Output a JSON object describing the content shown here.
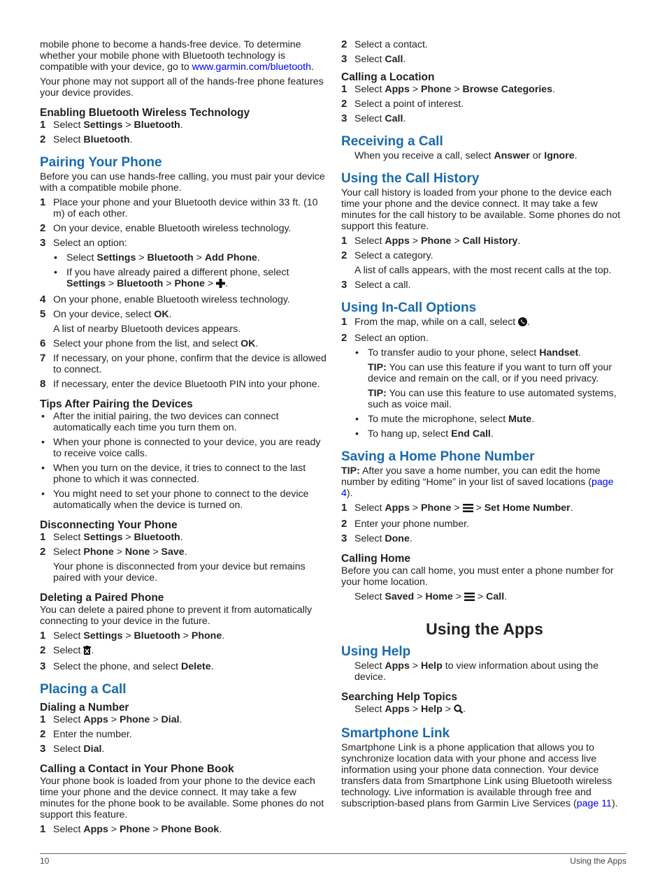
{
  "left": {
    "intro": {
      "p1_text": "mobile phone to become a hands-free device. To determine whether your mobile phone with Bluetooth technology is compatible with your device, go to ",
      "p1_link": "www.garmin.com/bluetooth",
      "p1_end": ".",
      "p2": "Your phone may not support all of the hands-free phone features your device provides."
    },
    "enabling": {
      "title": "Enabling Bluetooth Wireless Technology",
      "s1_num": "1",
      "s1_pre": "Select ",
      "s1_b1": "Settings",
      "s1_sep": " > ",
      "s1_b2": "Bluetooth",
      "s1_end": ".",
      "s2_num": "2",
      "s2_pre": "Select ",
      "s2_b1": "Bluetooth",
      "s2_end": "."
    },
    "pairing": {
      "title": "Pairing Your Phone",
      "intro": "Before you can use hands-free calling, you must pair your device with a compatible mobile phone.",
      "s1_num": "1",
      "s1": "Place your phone and your Bluetooth device within 33 ft. (10 m) of each other.",
      "s2_num": "2",
      "s2": "On your device, enable Bluetooth wireless technology.",
      "s3_num": "3",
      "s3": "Select an option:",
      "b1_pre": "Select ",
      "b1_a": "Settings",
      "b1_b": "Bluetooth",
      "b1_c": "Add Phone",
      "b2_pre": "If you have already paired a different phone, select ",
      "b2_a": "Settings",
      "b2_b": "Bluetooth",
      "b2_c": "Phone",
      "sep": " > ",
      "dot": "•",
      "end": ".",
      "s4_num": "4",
      "s4": "On your phone, enable Bluetooth wireless technology.",
      "s5_num": "5",
      "s5_pre": "On your device, select ",
      "s5_b": "OK",
      "s5_note": "A list of nearby Bluetooth devices appears.",
      "s6_num": "6",
      "s6_pre": "Select your phone from the list, and select ",
      "s6_b": "OK",
      "s7_num": "7",
      "s7": "If necessary, on your phone, confirm that the device is allowed to connect.",
      "s8_num": "8",
      "s8": "If necessary, enter the device Bluetooth PIN into your phone."
    },
    "tips": {
      "title": "Tips After Pairing the Devices",
      "items": [
        "After the initial pairing, the two devices can connect automatically each time you turn them on.",
        "When your phone is connected to your device, you are ready to receive voice calls.",
        "When you turn on the device, it tries to connect to the last phone to which it was connected.",
        "You might need to set your phone to connect to the device automatically when the device is turned on."
      ]
    },
    "disconnecting": {
      "title": "Disconnecting Your Phone",
      "s1_num": "1",
      "s1_pre": "Select ",
      "s1_a": "Settings",
      "s1_b": "Bluetooth",
      "s2_num": "2",
      "s2_pre": "Select ",
      "s2_a": "Phone",
      "s2_b": "None",
      "s2_c": "Save",
      "note": "Your phone is disconnected from your device but remains paired with your device."
    },
    "deleting": {
      "title": "Deleting a Paired Phone",
      "intro": "You can delete a paired phone to prevent it from automatically connecting to your device in the future.",
      "s1_num": "1",
      "s1_pre": "Select ",
      "s1_a": "Settings",
      "s1_b": "Bluetooth",
      "s1_c": "Phone",
      "s2_num": "2",
      "s2_pre": "Select ",
      "s3_num": "3",
      "s3_pre": "Select the phone, and select ",
      "s3_b": "Delete"
    },
    "placing": {
      "title": "Placing a Call",
      "dialing_title": "Dialing a Number",
      "d1_num": "1",
      "d1_pre": "Select ",
      "d1_a": "Apps",
      "d1_b": "Phone",
      "d1_c": "Dial",
      "d2_num": "2",
      "d2": "Enter the number.",
      "d3_num": "3",
      "d3_pre": "Select ",
      "d3_b": "Dial",
      "book_title": "Calling a Contact in Your Phone Book",
      "book_intro": "Your phone book is loaded from your phone to the device each time your phone and the device connect. It may take a few minutes for the phone book to be available. Some phones do not support this feature.",
      "b1_num": "1",
      "b1_pre": "Select ",
      "b1_a": "Apps",
      "b1_b": "Phone",
      "b1_c": "Phone Book"
    }
  },
  "right": {
    "contact": {
      "s2_num": "2",
      "s2": "Select a contact.",
      "s3_num": "3",
      "s3_pre": "Select ",
      "s3_b": "Call"
    },
    "location": {
      "title": "Calling a Location",
      "s1_num": "1",
      "s1_pre": "Select ",
      "s1_a": "Apps",
      "s1_b": "Phone",
      "s1_c": "Browse Categories",
      "s2_num": "2",
      "s2": "Select a point of interest.",
      "s3_num": "3",
      "s3_pre": "Select ",
      "s3_b": "Call"
    },
    "receiving": {
      "title": "Receiving a Call",
      "pre": "When you receive a call, select ",
      "a": "Answer",
      "mid": " or ",
      "b": "Ignore"
    },
    "history": {
      "title": "Using the Call History",
      "intro": "Your call history is loaded from your phone to the device each time your phone and the device connect. It may take a few minutes for the call history to be available. Some phones do not support this feature.",
      "s1_num": "1",
      "s1_pre": "Select ",
      "s1_a": "Apps",
      "s1_b": "Phone",
      "s1_c": "Call History",
      "s2_num": "2",
      "s2": "Select a category.",
      "s2_note": "A list of calls appears, with the most recent calls at the top.",
      "s3_num": "3",
      "s3": "Select a call."
    },
    "incall": {
      "title": "Using In-Call Options",
      "s1_num": "1",
      "s1_pre": "From the map, while on a call, select ",
      "s2_num": "2",
      "s2": "Select an option.",
      "b1_pre": "To transfer audio to your phone, select ",
      "b1_b": "Handset",
      "tip_label": "TIP:",
      "tip1": " You can use this feature if you want to turn off your device and remain on the call, or if you need privacy.",
      "tip2": " You can use this feature to use automated systems, such as voice mail.",
      "b2_pre": "To mute the microphone, select ",
      "b2_b": "Mute",
      "b3_pre": "To hang up, select ",
      "b3_b": "End Call"
    },
    "home": {
      "title": "Saving a Home Phone Number",
      "tip_label": "TIP:",
      "tip": " After you save a home number, you can edit the home number by editing “Home” in your list of saved locations (",
      "tip_link": "page 4",
      "tip_end": ").",
      "s1_num": "1",
      "s1_pre": "Select ",
      "s1_a": "Apps",
      "s1_b": "Phone",
      "s1_c": "Set Home Number",
      "s2_num": "2",
      "s2": "Enter your phone number.",
      "s3_num": "3",
      "s3_pre": "Select ",
      "s3_b": "Done",
      "calling_title": "Calling Home",
      "calling_intro": "Before you can call home, you must enter a phone number for your home location.",
      "c_pre": "Select ",
      "c_a": "Saved",
      "c_b": "Home",
      "c_c": "Call"
    },
    "apps": {
      "chapter_title": "Using the Apps",
      "help_title": "Using Help",
      "help_pre": "Select ",
      "help_a": "Apps",
      "help_b": "Help",
      "help_post": " to view information about using the device.",
      "search_title": "Searching Help Topics",
      "search_pre": "Select ",
      "search_a": "Apps",
      "search_b": "Help",
      "link_title": "Smartphone Link",
      "link_text": "Smartphone Link is a phone application that allows you to synchronize location data with your phone and access live information using your phone data connection. Your device transfers data from Smartphone Link using Bluetooth wireless technology. Live information is available through free and subscription-based plans from Garmin Live Services (",
      "link_page": "page 11",
      "link_end": ")."
    }
  },
  "footer": {
    "page_number": "10",
    "section": "Using the Apps"
  },
  "common": {
    "sep": " > ",
    "end": ".",
    "dot": "•"
  }
}
